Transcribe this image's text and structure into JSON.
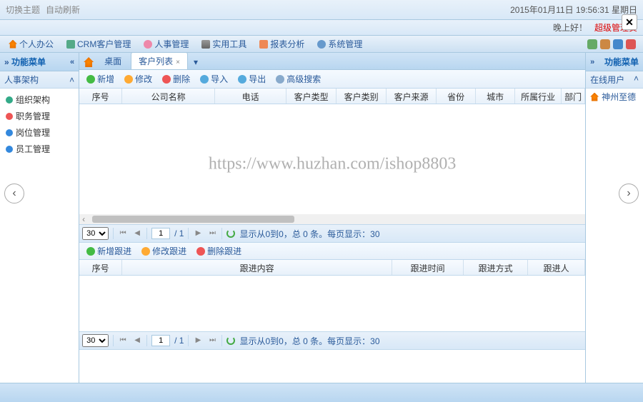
{
  "topbar": {
    "datetime": "2015年01月11日 19:56:31 星期日",
    "greeting": "晚上好！",
    "admin": "超级管理员",
    "left1": "切换主题",
    "left2": "自动刷新"
  },
  "menu": {
    "items": [
      {
        "label": "个人办公"
      },
      {
        "label": "CRM客户管理"
      },
      {
        "label": "人事管理"
      },
      {
        "label": "实用工具"
      },
      {
        "label": "报表分析"
      },
      {
        "label": "系统管理"
      }
    ]
  },
  "leftPanel": {
    "title": "功能菜单",
    "accordion": "人事架构",
    "tree": [
      {
        "label": "组织架构"
      },
      {
        "label": "职务管理"
      },
      {
        "label": "岗位管理"
      },
      {
        "label": "员工管理"
      }
    ]
  },
  "tabs": {
    "t1": "桌面",
    "t2": "客户列表"
  },
  "toolbar": {
    "add": "新增",
    "edit": "修改",
    "del": "删除",
    "imp": "导入",
    "exp": "导出",
    "search": "高级搜索"
  },
  "grid1": {
    "cols": [
      "序号",
      "公司名称",
      "电话",
      "客户类型",
      "客户类别",
      "客户来源",
      "省份",
      "城市",
      "所属行业",
      "部门"
    ]
  },
  "pager": {
    "pagesize": "30",
    "page": "1",
    "total": "/ 1",
    "msg": "显示从0到0，总 0 条。每页显示：30"
  },
  "subToolbar": {
    "add": "新增跟进",
    "edit": "修改跟进",
    "del": "删除跟进"
  },
  "grid2": {
    "cols": [
      "序号",
      "跟进内容",
      "跟进时间",
      "跟进方式",
      "跟进人"
    ]
  },
  "rightPanel": {
    "title": "功能菜单",
    "online": "在线用户",
    "user": "神州至德"
  },
  "watermark": "https://www.huzhan.com/ishop8803"
}
